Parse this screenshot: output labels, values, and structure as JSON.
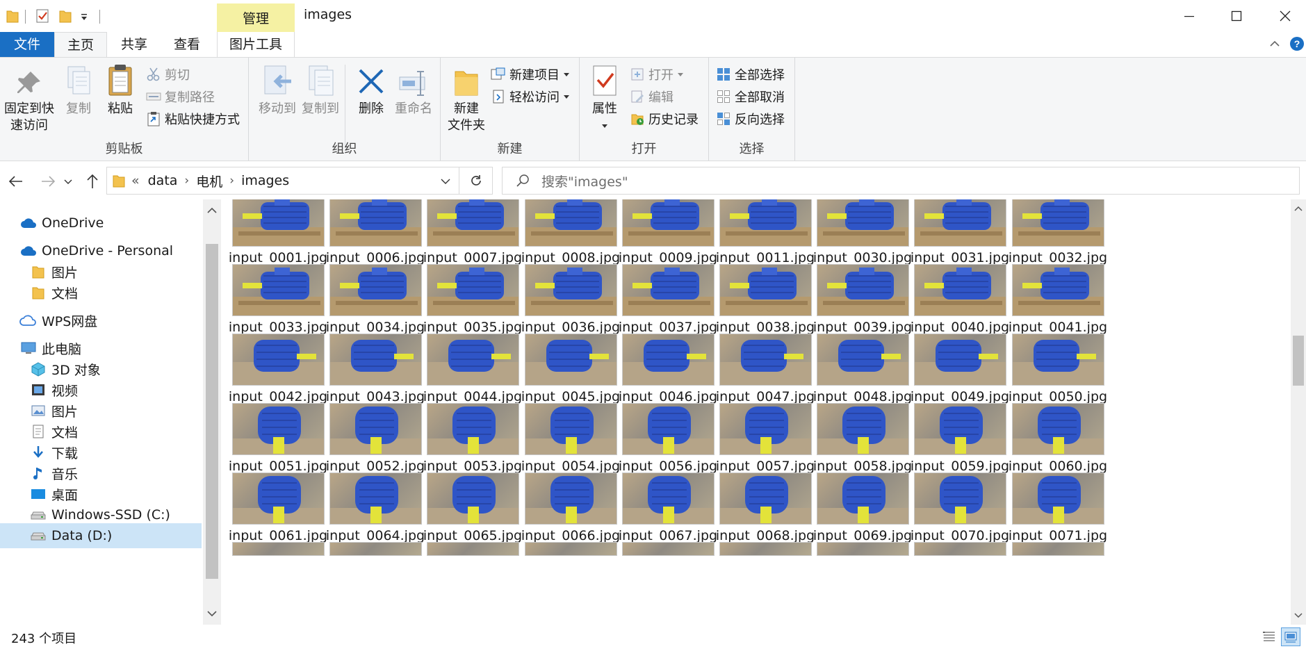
{
  "window": {
    "title": "images",
    "contextual_tab": "管理",
    "controls": [
      "minimize",
      "maximize",
      "close"
    ]
  },
  "ribbon_tabs": {
    "file": "文件",
    "home": "主页",
    "share": "共享",
    "view": "查看",
    "picture_tools": "图片工具"
  },
  "ribbon": {
    "clipboard": {
      "label": "剪贴板",
      "pin": "固定到快\n速访问",
      "pin_line1": "固定到快",
      "pin_line2": "速访问",
      "copy": "复制",
      "paste": "粘贴",
      "cut": "剪切",
      "copy_path": "复制路径",
      "paste_shortcut": "粘贴快捷方式"
    },
    "organize": {
      "label": "组织",
      "move_to": "移动到",
      "copy_to": "复制到",
      "delete": "删除",
      "rename": "重命名"
    },
    "new": {
      "label": "新建",
      "new_folder_line1": "新建",
      "new_folder_line2": "文件夹",
      "new_item": "新建项目",
      "easy_access": "轻松访问"
    },
    "open": {
      "label": "打开",
      "properties": "属性",
      "open": "打开",
      "edit": "编辑",
      "history": "历史记录"
    },
    "select": {
      "label": "选择",
      "select_all": "全部选择",
      "select_none": "全部取消",
      "invert": "反向选择"
    }
  },
  "address": {
    "overflow": "«",
    "crumbs": [
      "data",
      "电机",
      "images"
    ],
    "search_placeholder": "搜索\"images\""
  },
  "nav_pane": [
    {
      "label": "OneDrive",
      "icon": "cloud-icon"
    },
    {
      "label": "OneDrive - Personal",
      "icon": "cloud-icon"
    },
    {
      "label": "图片",
      "icon": "folder-icon"
    },
    {
      "label": "文档",
      "icon": "folder-icon"
    },
    {
      "label": "WPS网盘",
      "icon": "wps-cloud-icon"
    },
    {
      "label": "此电脑",
      "icon": "computer-icon"
    },
    {
      "label": "3D 对象",
      "icon": "3d-objects-icon"
    },
    {
      "label": "视频",
      "icon": "video-icon"
    },
    {
      "label": "图片",
      "icon": "pictures-icon"
    },
    {
      "label": "文档",
      "icon": "documents-icon"
    },
    {
      "label": "下载",
      "icon": "download-icon"
    },
    {
      "label": "音乐",
      "icon": "music-icon"
    },
    {
      "label": "桌面",
      "icon": "desktop-icon"
    },
    {
      "label": "Windows-SSD (C:)",
      "icon": "drive-icon"
    },
    {
      "label": "Data (D:)",
      "icon": "drive-icon"
    }
  ],
  "files": [
    "input_0001.jpg",
    "input_0006.jpg",
    "input_0007.jpg",
    "input_0008.jpg",
    "input_0009.jpg",
    "input_0011.jpg",
    "input_0030.jpg",
    "input_0031.jpg",
    "input_0032.jpg",
    "input_0033.jpg",
    "input_0034.jpg",
    "input_0035.jpg",
    "input_0036.jpg",
    "input_0037.jpg",
    "input_0038.jpg",
    "input_0039.jpg",
    "input_0040.jpg",
    "input_0041.jpg",
    "input_0042.jpg",
    "input_0043.jpg",
    "input_0044.jpg",
    "input_0045.jpg",
    "input_0046.jpg",
    "input_0047.jpg",
    "input_0048.jpg",
    "input_0049.jpg",
    "input_0050.jpg",
    "input_0051.jpg",
    "input_0052.jpg",
    "input_0053.jpg",
    "input_0054.jpg",
    "input_0056.jpg",
    "input_0057.jpg",
    "input_0058.jpg",
    "input_0059.jpg",
    "input_0060.jpg",
    "input_0061.jpg",
    "input_0064.jpg",
    "input_0065.jpg",
    "input_0066.jpg",
    "input_0067.jpg",
    "input_0068.jpg",
    "input_0069.jpg",
    "input_0070.jpg",
    "input_0071.jpg"
  ],
  "status": {
    "item_count": "243 个项目"
  },
  "colors": {
    "accent": "#1a6fc4",
    "manage_tab": "#f5f1a3",
    "motor_blue": "#2f55c7",
    "motor_shaft": "#e3e33a"
  }
}
